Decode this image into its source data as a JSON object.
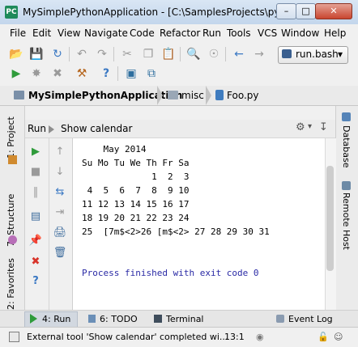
{
  "window": {
    "app_icon": "PC",
    "title": "MySimplePythonApplication - [C:\\SamplesProjects\\py\\...",
    "min": "–",
    "max": "□",
    "close": "✕"
  },
  "menu": [
    "File",
    "Edit",
    "View",
    "Navigate",
    "Code",
    "Refactor",
    "Run",
    "Tools",
    "VCS",
    "Window",
    "Help"
  ],
  "toolbar": {
    "icons": [
      "open-folder-icon",
      "save-icon",
      "sync-icon",
      "undo-icon",
      "redo-icon",
      "cut-icon",
      "copy-icon",
      "paste-icon",
      "find-icon",
      "replace-icon",
      "back-icon",
      "forward-icon",
      "run-icon",
      "debug-icon",
      "stop-icon",
      "settings-icon",
      "help-icon",
      "python-console-icon",
      "vcs-icon"
    ],
    "run_config": "run.bash",
    "run_config_icon": "terminal-icon",
    "glyphs": {
      "open": "📂",
      "save": "💾",
      "sync": "↻",
      "undo": "↶",
      "redo": "↷",
      "cut": "✂",
      "copy": "❐",
      "paste": "📋",
      "find": "🔍",
      "replace": "☉",
      "back": "←",
      "forward": "→",
      "run": "▶",
      "debug": "✸",
      "stop": "✖",
      "tools": "⚒",
      "help": "?",
      "pyconsole": "▣",
      "vcs": "⧉",
      "dropdown": "▾"
    }
  },
  "breadcrumb": [
    {
      "label": "MySimplePythonApplication",
      "icon": "project-folder-icon"
    },
    {
      "label": "misc",
      "icon": "folder-icon"
    },
    {
      "label": "Foo.py",
      "icon": "python-file-icon"
    }
  ],
  "left_strip": {
    "tabs": [
      {
        "label": "1: Project",
        "icon": "project-icon"
      },
      {
        "label": "7: Structure",
        "icon": "structure-icon"
      },
      {
        "label": "2: Favorites",
        "icon": "favorites-icon"
      }
    ]
  },
  "right_strip": {
    "tabs": [
      {
        "label": "Database",
        "icon": "database-icon"
      },
      {
        "label": "Remote Host",
        "icon": "remote-host-icon"
      }
    ]
  },
  "run_panel": {
    "prefix": "Run",
    "title": "Show calendar",
    "gear": "⚙",
    "gear_dropdown": "▾",
    "pin": "↧"
  },
  "run_actions": {
    "left": [
      "▶",
      "■",
      "‖",
      "▤",
      "📌",
      "✖",
      "?"
    ],
    "right": [
      "↑",
      "↓",
      "⇆",
      "⇥",
      "🖨",
      "🗑"
    ]
  },
  "console": {
    "lines": [
      "    May 2014",
      "Su Mo Tu We Th Fr Sa",
      "             1  2  3",
      " 4  5  6  7  8  9 10",
      "11 12 13 14 15 16 17",
      "18 19 20 21 22 23 24",
      "25  [7m$<2>26 [m$<2> 27 28 29 30 31"
    ],
    "exit_message": "Process finished with exit code 0",
    "exit_color": "#2a2aa5"
  },
  "bottom_tabs": [
    {
      "label": "4: Run",
      "icon": "run-icon",
      "active": true
    },
    {
      "label": "6: TODO",
      "icon": "todo-icon"
    },
    {
      "label": "Terminal",
      "icon": "terminal-icon"
    },
    {
      "label": "Event Log",
      "icon": "event-log-icon"
    }
  ],
  "status": {
    "message": "External tool 'Show calendar' completed wi...",
    "position": "13:1",
    "encoding_icon": "◉",
    "lock_icon": "🔓",
    "inspector_icon": "☺"
  }
}
